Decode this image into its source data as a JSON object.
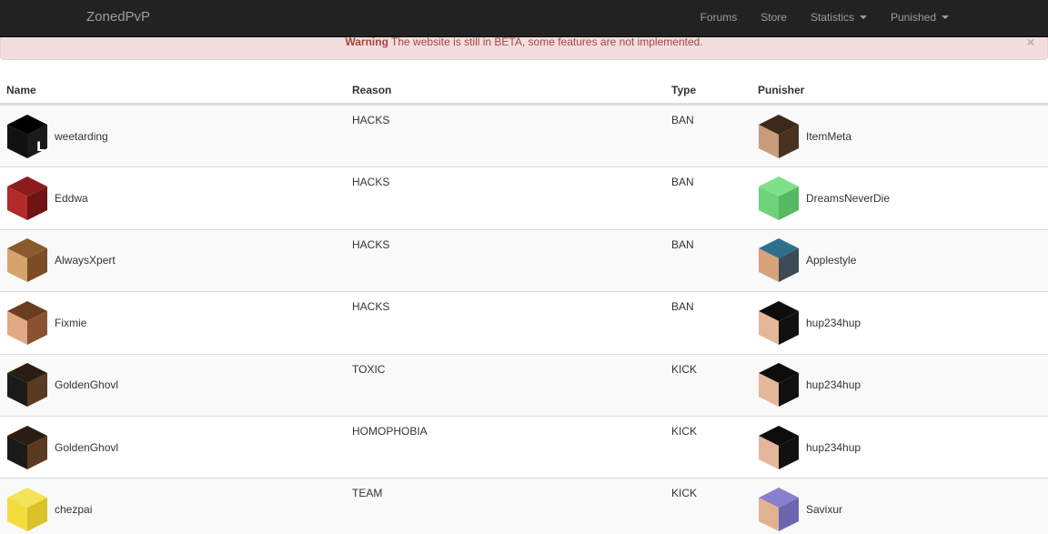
{
  "navbar": {
    "brand": "ZonedPvP",
    "links": [
      {
        "label": "Forums",
        "dropdown": false
      },
      {
        "label": "Store",
        "dropdown": false
      },
      {
        "label": "Statistics",
        "dropdown": true
      },
      {
        "label": "Punished",
        "dropdown": true
      }
    ]
  },
  "alert": {
    "strong": "Warning",
    "text": " The website is still in BETA, some features are not implemented.",
    "close": "×"
  },
  "table": {
    "headers": {
      "name": "Name",
      "reason": "Reason",
      "type": "Type",
      "punisher": "Punisher"
    },
    "rows": [
      {
        "name": "weetarding",
        "reason": "HACKS",
        "type": "BAN",
        "punisher": "ItemMeta",
        "name_head": {
          "top": "#000000",
          "left": "#111111",
          "right": "#1a1a1a",
          "glyph": "L"
        },
        "punisher_head": {
          "top": "#3b2a1a",
          "left": "#c89b7b",
          "right": "#4a3220",
          "glyph": ""
        }
      },
      {
        "name": "Eddwa",
        "reason": "HACKS",
        "type": "BAN",
        "punisher": "DreamsNeverDie",
        "name_head": {
          "top": "#8c1c1c",
          "left": "#b22a2a",
          "right": "#6e1414",
          "glyph": ""
        },
        "punisher_head": {
          "top": "#7fe08a",
          "left": "#6ed27a",
          "right": "#55b862",
          "glyph": ""
        }
      },
      {
        "name": "AlwaysXpert",
        "reason": "HACKS",
        "type": "BAN",
        "punisher": "Applestyle",
        "name_head": {
          "top": "#8b5a2b",
          "left": "#d6a36d",
          "right": "#7a4d22",
          "glyph": ""
        },
        "punisher_head": {
          "top": "#2e6f8e",
          "left": "#d9a27a",
          "right": "#3b4a55",
          "glyph": ""
        }
      },
      {
        "name": "Fixmie",
        "reason": "HACKS",
        "type": "BAN",
        "punisher": "hup234hup",
        "name_head": {
          "top": "#6b3e22",
          "left": "#e0a883",
          "right": "#8a5230",
          "glyph": ""
        },
        "punisher_head": {
          "top": "#0d0d0d",
          "left": "#e4b79a",
          "right": "#111111",
          "glyph": ""
        }
      },
      {
        "name": "GoldenGhovl",
        "reason": "TOXIC",
        "type": "KICK",
        "punisher": "hup234hup",
        "name_head": {
          "top": "#2b1d12",
          "left": "#1a1a1a",
          "right": "#5a3b22",
          "glyph": ""
        },
        "punisher_head": {
          "top": "#0d0d0d",
          "left": "#e4b79a",
          "right": "#111111",
          "glyph": ""
        }
      },
      {
        "name": "GoldenGhovl",
        "reason": "HOMOPHOBIA",
        "type": "KICK",
        "punisher": "hup234hup",
        "name_head": {
          "top": "#2b1d12",
          "left": "#1a1a1a",
          "right": "#5a3b22",
          "glyph": ""
        },
        "punisher_head": {
          "top": "#0d0d0d",
          "left": "#e4b79a",
          "right": "#111111",
          "glyph": ""
        }
      },
      {
        "name": "chezpai",
        "reason": "TEAM",
        "type": "KICK",
        "punisher": "Savixur",
        "name_head": {
          "top": "#f5e35a",
          "left": "#f2dc3e",
          "right": "#d9c22a",
          "glyph": ""
        },
        "punisher_head": {
          "top": "#8a7fcf",
          "left": "#e0b293",
          "right": "#6e66ad",
          "glyph": ""
        }
      }
    ]
  }
}
